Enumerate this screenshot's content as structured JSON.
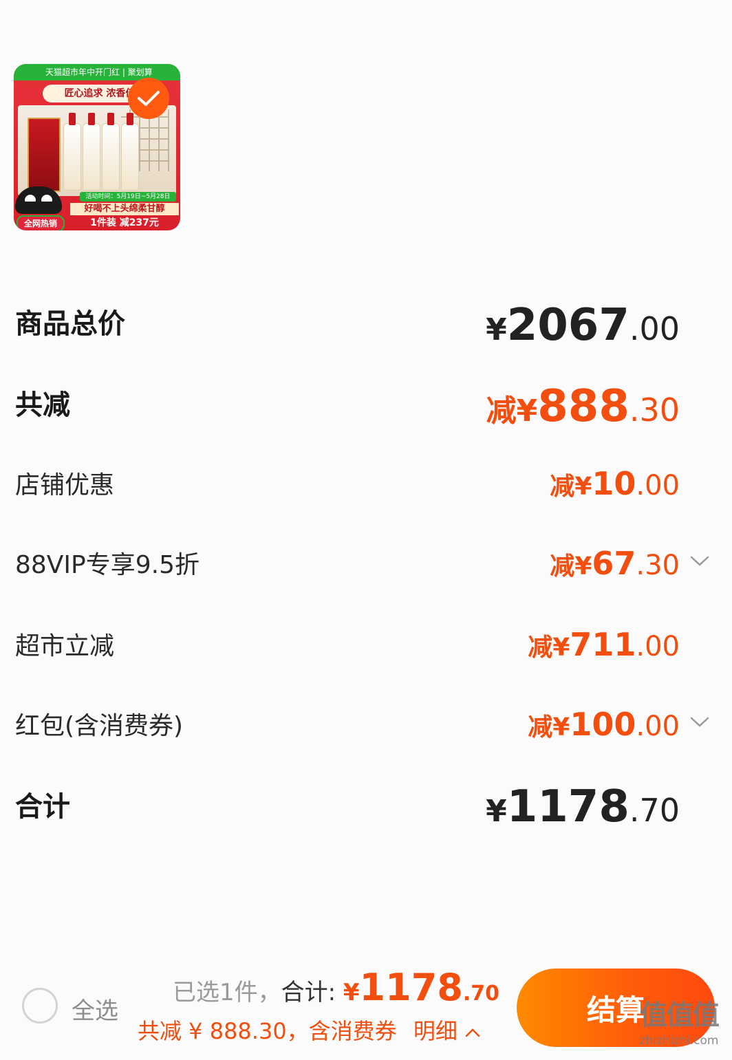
{
  "product": {
    "top_banner": "天猫超市年中开门红 | 聚划算",
    "slogan": "匠心追求  浓香佳酿",
    "date_strip": "活动时间：5月19日~5月28日",
    "tagline": "好喝不上头绵柔甘醇",
    "promo": "1件装 减237元",
    "hot_tag": "全网热销",
    "selected": true
  },
  "summary": {
    "total_label": "商品总价",
    "total_currency": "¥",
    "total_int": "2067",
    "total_dec": ".00",
    "reduce_label": "共减",
    "reduce_prefix": "减¥",
    "reduce_int": "888",
    "reduce_dec": ".30",
    "store_label": "店铺优惠",
    "store_prefix": "减¥",
    "store_int": "10",
    "store_dec": ".00",
    "vip_label": "88VIP专享9.5折",
    "vip_prefix": "减¥",
    "vip_int": "67",
    "vip_dec": ".30",
    "market_label": "超市立减",
    "market_prefix": "减¥",
    "market_int": "711",
    "market_dec": ".00",
    "redpack_label": "红包(含消费券)",
    "redpack_prefix": "减¥",
    "redpack_int": "100",
    "redpack_dec": ".00",
    "sum_label": "合计",
    "sum_currency": "¥",
    "sum_int": "1178",
    "sum_dec": ".70"
  },
  "bottom_bar": {
    "select_all": "全选",
    "selected_count": "已选1件，",
    "sum_label": "合计:",
    "sum_currency": "¥",
    "sum_int": "1178",
    "sum_dec": ".70",
    "save_text": "共减 ¥ 888.30，含消费券",
    "detail_label": "明细",
    "checkout_label": "结算"
  },
  "watermark": {
    "logo": "值值值",
    "url": "zhizhizhi.com"
  },
  "colors": {
    "accent": "#f24e0f",
    "checkout_start": "#ff8a00",
    "checkout_end": "#ff4a0f",
    "background": "#fbfbfb"
  }
}
